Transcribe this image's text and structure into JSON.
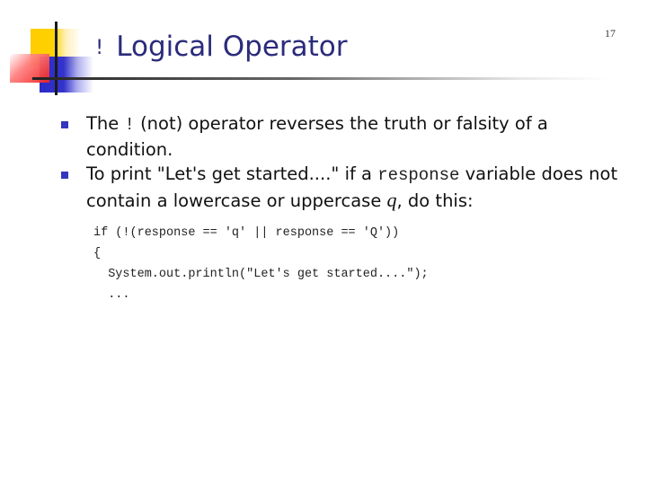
{
  "slide": {
    "page_number": "17",
    "title": {
      "operator": "!",
      "text": "Logical Operator"
    },
    "bullets": [
      {
        "part1": "The ",
        "code": "!",
        "part2": " (not) operator reverses the truth or falsity of a condition."
      },
      {
        "part1": "To print \"Let's get started....\" if a ",
        "code": "response",
        "part2": " variable does not contain a lowercase or uppercase ",
        "italic": "q",
        "part3": ", do this:"
      }
    ],
    "code_lines": [
      "if (!(response == 'q' || response == 'Q'))",
      "{",
      "  System.out.println(\"Let's get started....\");",
      "  ..."
    ],
    "colors": {
      "title": "#2b2b7c",
      "bullet": "#3535c0",
      "logo_yellow": "#ffcc00",
      "logo_blue": "#2a2ac8",
      "logo_red": "#ee2020"
    }
  }
}
